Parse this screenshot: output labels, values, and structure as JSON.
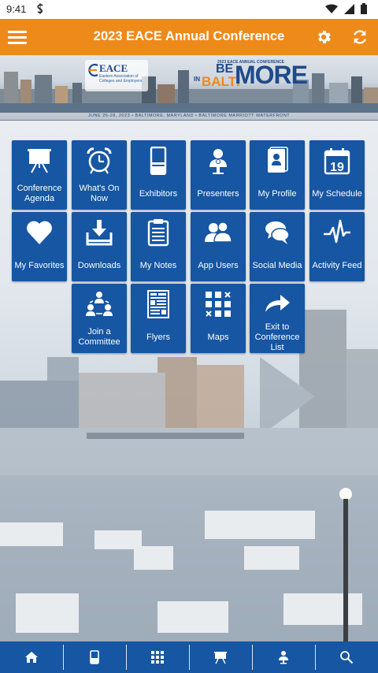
{
  "status_bar": {
    "time": "9:41",
    "icons": [
      "sim-icon",
      "wifi-icon",
      "signal-icon",
      "battery-icon"
    ]
  },
  "app_bar": {
    "title": "2023 EACE Annual Conference",
    "icons": [
      "menu-icon",
      "gear-icon",
      "refresh-icon"
    ],
    "color": "#ee8a1a"
  },
  "banner": {
    "org_name": "EACE",
    "org_subtitle": "Eastern Association of Colleges and Employers",
    "small_heading": "2023 EACE ANNUAL CONFERENCE",
    "be": "BE",
    "in": "IN",
    "balti": "BALTI",
    "more": "MORE",
    "caption": "JUNE 26-28, 2023  •  BALTIMORE, MARYLAND  •  BALTIMORE MARRIOTT WATERFRONT"
  },
  "tiles": [
    {
      "label": "Conference Agenda",
      "icon": "easel-icon"
    },
    {
      "label": "What's On Now",
      "icon": "alarm-clock-icon"
    },
    {
      "label": "Exhibitors",
      "icon": "booth-icon"
    },
    {
      "label": "Presenters",
      "icon": "presenter-icon"
    },
    {
      "label": "My Profile",
      "icon": "profile-card-icon"
    },
    {
      "label": "My Schedule",
      "icon": "calendar-icon",
      "calendar_day": "19"
    },
    {
      "label": "My Favorites",
      "icon": "heart-icon"
    },
    {
      "label": "Downloads",
      "icon": "download-tray-icon"
    },
    {
      "label": "My Notes",
      "icon": "clipboard-icon"
    },
    {
      "label": "App Users",
      "icon": "users-icon"
    },
    {
      "label": "Social Media",
      "icon": "chat-bubbles-icon"
    },
    {
      "label": "Activity Feed",
      "icon": "pulse-icon"
    },
    {
      "label": "Join a Committee",
      "icon": "committee-icon"
    },
    {
      "label": "Flyers",
      "icon": "flyer-icon"
    },
    {
      "label": "Maps",
      "icon": "map-grid-icon"
    },
    {
      "label": "Exit to Conference List",
      "icon": "exit-arrow-icon"
    }
  ],
  "bottom_nav": [
    "home-icon",
    "phone-icon",
    "grid-icon",
    "easel-icon",
    "presenter-icon",
    "search-icon"
  ],
  "colors": {
    "tile": "#1656a3",
    "accent": "#ee8a1a",
    "nav": "#1656a3"
  }
}
